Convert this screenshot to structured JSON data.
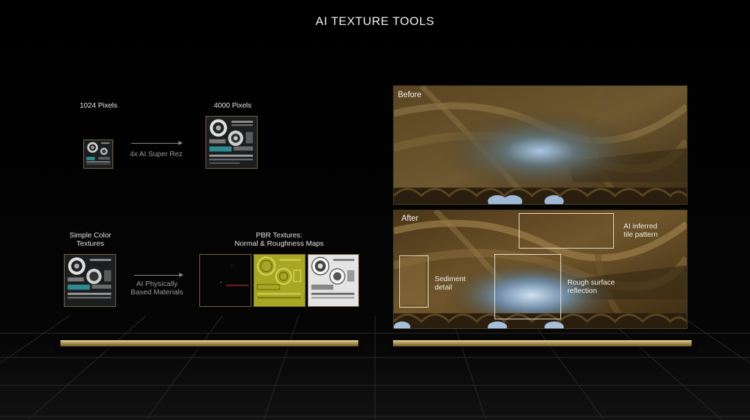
{
  "title": "AI TEXTURE TOOLS",
  "superres": {
    "left_label": "1024 Pixels",
    "right_label": "4000 Pixels",
    "arrow_label": "4x AI Super Rez"
  },
  "pbr": {
    "left_label_line1": "Simple Color",
    "left_label_line2": "Textures",
    "right_label_line1": "PBR Textures:",
    "right_label_line2": "Normal & Roughness Maps",
    "arrow_label_line1": "AI Physically",
    "arrow_label_line2": "Based Materials"
  },
  "before_panel": {
    "label": "Before"
  },
  "after_panel": {
    "label": "After",
    "annotations": {
      "tile_line1": "AI inferred",
      "tile_line2": "tile pattern",
      "sediment_line1": "Sediment",
      "sediment_line2": "detail",
      "rough_line1": "Rough surface",
      "rough_line2": "reflection"
    }
  },
  "colors": {
    "background": "#000000",
    "accent_gold": "#b59c5d",
    "normal_map": "#a8a623",
    "annotation_box": "#e9e2cc"
  },
  "icons": [
    "arrow-right-icon",
    "arrow-right-icon"
  ]
}
